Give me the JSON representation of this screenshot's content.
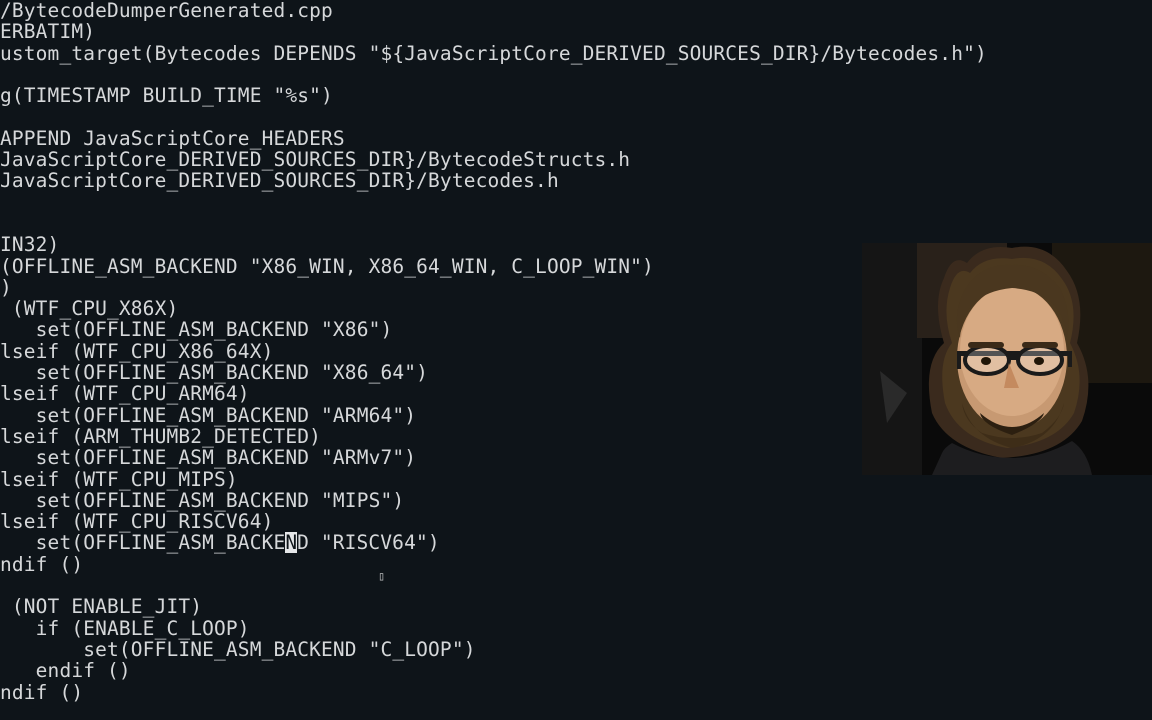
{
  "lines": [
    "/BytecodeDumperGenerated.cpp",
    "ERBATIM)",
    "ustom_target(Bytecodes DEPENDS \"${JavaScriptCore_DERIVED_SOURCES_DIR}/Bytecodes.h\")",
    "",
    "g(TIMESTAMP BUILD_TIME \"%s\")",
    "",
    "APPEND JavaScriptCore_HEADERS",
    "JavaScriptCore_DERIVED_SOURCES_DIR}/BytecodeStructs.h",
    "JavaScriptCore_DERIVED_SOURCES_DIR}/Bytecodes.h",
    "",
    "",
    "IN32)",
    "(OFFLINE_ASM_BACKEND \"X86_WIN, X86_64_WIN, C_LOOP_WIN\")",
    ")",
    " (WTF_CPU_X86X)",
    "   set(OFFLINE_ASM_BACKEND \"X86\")",
    "lseif (WTF_CPU_X86_64X)",
    "   set(OFFLINE_ASM_BACKEND \"X86_64\")",
    "lseif (WTF_CPU_ARM64)",
    "   set(OFFLINE_ASM_BACKEND \"ARM64\")",
    "lseif (ARM_THUMB2_DETECTED)",
    "   set(OFFLINE_ASM_BACKEND \"ARMv7\")",
    "lseif (WTF_CPU_MIPS)",
    "   set(OFFLINE_ASM_BACKEND \"MIPS\")",
    "lseif (WTF_CPU_RISCV64)",
    {
      "before": "   set(OFFLINE_ASM_BACKE",
      "cursor_char": "N",
      "after": "D \"RISCV64\")"
    },
    "ndif ()",
    "",
    " (NOT ENABLE_JIT)",
    "   if (ENABLE_C_LOOP)",
    "       set(OFFLINE_ASM_BACKEND \"C_LOOP\")",
    "   endif ()",
    "ndif ()"
  ],
  "webcam": {
    "label": "webcam-overlay"
  }
}
